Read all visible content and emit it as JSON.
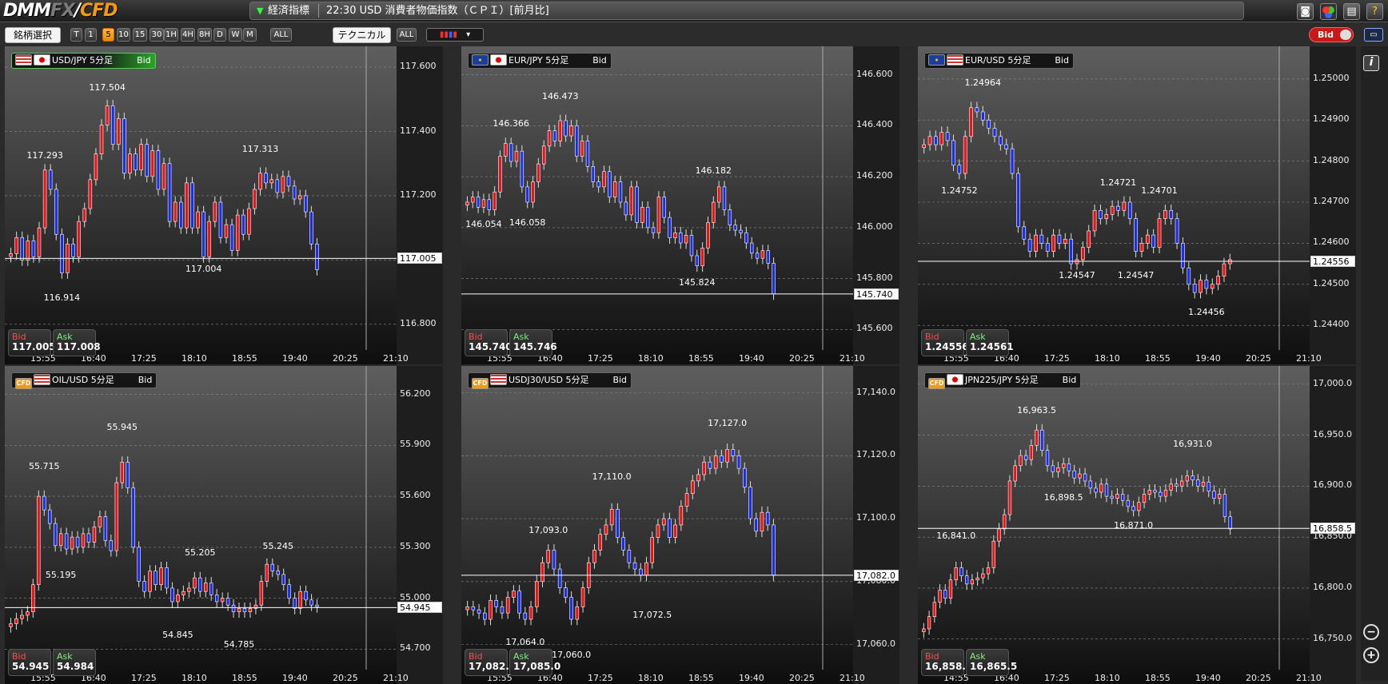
{
  "app": {
    "logo_main": "DMM",
    "logo_fx": "FX",
    "logo_sep": "/",
    "logo_cfd": "CFD"
  },
  "ticker": {
    "category": "経済指標",
    "news": "22:30 USD 消費者物価指数（ＣＰＩ）[前月比]"
  },
  "top_icons": [
    "camera-icon",
    "color-palette-icon",
    "print-icon",
    "help-icon"
  ],
  "toolbar": {
    "symbol_select": "銘柄選択",
    "timeframes": [
      "T",
      "1",
      "5",
      "10",
      "15",
      "30",
      "1H",
      "4H",
      "8H",
      "D",
      "W",
      "M"
    ],
    "active_timeframe": "5",
    "all_label": "ALL",
    "technical_label": "テクニカル",
    "technical_all": "ALL",
    "bid_toggle": "Bid"
  },
  "colors": {
    "up": "#e8141a",
    "down": "#1a2de8",
    "flat": "#d6c326",
    "accent": "#f39a12",
    "bid_text": "#ff4c4c",
    "ask_text": "#7cf07c"
  },
  "panels": [
    {
      "header": "USD/JPY 5分足",
      "bid_label": "Bid",
      "flags": [
        "us",
        "jp"
      ],
      "active": true,
      "yticks": [
        "117.600",
        "117.400",
        "117.200",
        "117.000",
        "116.800"
      ],
      "ymin": 116.72,
      "ymax": 117.64,
      "current": "117.005",
      "current_value": 117.005,
      "xticks": [
        "15:55",
        "16:40",
        "17:25",
        "18:10",
        "18:55",
        "19:40",
        "20:25",
        "21:10"
      ],
      "bid_quote": "117.005",
      "ask_quote": "117.008",
      "annotations": [
        {
          "text": "117.504",
          "value": 117.504,
          "idx": 17,
          "pos": "above"
        },
        {
          "text": "117.293",
          "value": 117.293,
          "idx": 6,
          "pos": "above"
        },
        {
          "text": "117.313",
          "value": 117.313,
          "idx": 44,
          "pos": "above"
        },
        {
          "text": "116.914",
          "value": 116.914,
          "idx": 9,
          "pos": "below"
        },
        {
          "text": "117.004",
          "value": 117.004,
          "idx": 34,
          "pos": "below"
        }
      ],
      "candles": [
        117.02,
        117.07,
        117.0,
        117.06,
        117.01,
        117.1,
        117.28,
        117.22,
        117.08,
        116.96,
        117.05,
        117.01,
        117.12,
        117.16,
        117.25,
        117.33,
        117.42,
        117.48,
        117.36,
        117.44,
        117.27,
        117.33,
        117.28,
        117.36,
        117.26,
        117.34,
        117.22,
        117.3,
        117.12,
        117.18,
        117.1,
        117.24,
        117.1,
        117.15,
        117.01,
        117.12,
        117.18,
        117.07,
        117.11,
        117.03,
        117.14,
        117.08,
        117.16,
        117.22,
        117.27,
        117.24,
        117.25,
        117.21,
        117.26,
        117.23,
        117.19,
        117.2,
        117.15,
        117.05,
        116.97
      ]
    },
    {
      "header": "EUR/JPY 5分足",
      "bid_label": "Bid",
      "flags": [
        "eu",
        "jp"
      ],
      "active": false,
      "yticks": [
        "146.600",
        "146.400",
        "146.200",
        "146.000",
        "145.800",
        "145.600"
      ],
      "ymin": 145.52,
      "ymax": 146.68,
      "current": "145.740",
      "current_value": 145.74,
      "xticks": [
        "15:55",
        "16:40",
        "17:25",
        "18:10",
        "18:55",
        "19:40",
        "20:25",
        "21:10"
      ],
      "bid_quote": "145.740",
      "ask_quote": "145.746",
      "annotations": [
        {
          "text": "146.473",
          "value": 146.473,
          "idx": 17,
          "pos": "above"
        },
        {
          "text": "146.366",
          "value": 146.366,
          "idx": 8,
          "pos": "above"
        },
        {
          "text": "146.182",
          "value": 146.182,
          "idx": 45,
          "pos": "above"
        },
        {
          "text": "146.054",
          "value": 146.054,
          "idx": 3,
          "pos": "below"
        },
        {
          "text": "146.058",
          "value": 146.058,
          "idx": 11,
          "pos": "below"
        },
        {
          "text": "145.824",
          "value": 145.824,
          "idx": 42,
          "pos": "below"
        }
      ],
      "candles": [
        146.1,
        146.12,
        146.08,
        146.11,
        146.07,
        146.14,
        146.28,
        146.33,
        146.26,
        146.3,
        146.16,
        146.1,
        146.18,
        146.25,
        146.32,
        146.38,
        146.34,
        146.42,
        146.36,
        146.4,
        146.28,
        146.34,
        146.24,
        146.18,
        146.16,
        146.22,
        146.12,
        146.18,
        146.1,
        146.05,
        146.16,
        146.02,
        146.08,
        146.0,
        145.98,
        146.12,
        146.04,
        145.96,
        145.98,
        145.94,
        145.97,
        145.89,
        145.85,
        145.92,
        146.02,
        146.1,
        146.16,
        146.07,
        146.01,
        145.99,
        145.98,
        145.94,
        145.9,
        145.88,
        145.91,
        145.86,
        145.74
      ]
    },
    {
      "header": "EUR/USD 5分足",
      "bid_label": "Bid",
      "flags": [
        "eu",
        "us"
      ],
      "active": false,
      "yticks": [
        "1.25000",
        "1.24900",
        "1.24800",
        "1.24700",
        "1.24600",
        "1.24500",
        "1.24400"
      ],
      "ymin": 1.2434,
      "ymax": 1.2506,
      "current": "1.24556",
      "current_value": 1.24556,
      "xticks": [
        "15:55",
        "16:40",
        "17:25",
        "18:10",
        "18:55",
        "19:40",
        "20:25",
        "21:10"
      ],
      "bid_quote": "1.24556",
      "ask_quote": "1.24561",
      "annotations": [
        {
          "text": "1.24964",
          "value": 1.24964,
          "idx": 10,
          "pos": "above"
        },
        {
          "text": "1.24752",
          "value": 1.24752,
          "idx": 6,
          "pos": "below"
        },
        {
          "text": "1.24721",
          "value": 1.24721,
          "idx": 33,
          "pos": "above"
        },
        {
          "text": "1.24701",
          "value": 1.24701,
          "idx": 40,
          "pos": "above"
        },
        {
          "text": "1.24547",
          "value": 1.24547,
          "idx": 26,
          "pos": "below"
        },
        {
          "text": "1.24547",
          "value": 1.24547,
          "idx": 36,
          "pos": "below"
        },
        {
          "text": "1.24456",
          "value": 1.24456,
          "idx": 48,
          "pos": "below"
        }
      ],
      "candles": [
        1.2484,
        1.2486,
        1.2484,
        1.2487,
        1.2485,
        1.2479,
        1.2477,
        1.2486,
        1.2493,
        1.2492,
        1.249,
        1.2488,
        1.2486,
        1.2484,
        1.2483,
        1.2477,
        1.2464,
        1.2461,
        1.2458,
        1.2462,
        1.246,
        1.2458,
        1.2462,
        1.246,
        1.2461,
        1.2455,
        1.2456,
        1.2459,
        1.2463,
        1.2468,
        1.2466,
        1.2467,
        1.2469,
        1.2468,
        1.247,
        1.2466,
        1.2458,
        1.246,
        1.2462,
        1.2459,
        1.2466,
        1.2468,
        1.2466,
        1.246,
        1.2454,
        1.245,
        1.2448,
        1.2451,
        1.2449,
        1.245,
        1.2452,
        1.2455,
        1.2456
      ]
    },
    {
      "header": "OIL/USD 5分足",
      "bid_label": "Bid",
      "flags": [
        "cfd",
        "us"
      ],
      "active": false,
      "yticks": [
        "56.200",
        "55.900",
        "55.600",
        "55.300",
        "55.000",
        "54.700"
      ],
      "ymin": 54.58,
      "ymax": 56.32,
      "current": "54.945",
      "current_value": 54.945,
      "xticks": [
        "15:55",
        "16:40",
        "17:25",
        "18:10",
        "18:55",
        "19:40",
        "20:25",
        "21:10"
      ],
      "bid_quote": "54.945",
      "ask_quote": "54.984",
      "annotations": [
        {
          "text": "55.945",
          "value": 55.945,
          "idx": 20,
          "pos": "above"
        },
        {
          "text": "55.715",
          "value": 55.715,
          "idx": 6,
          "pos": "above"
        },
        {
          "text": "55.195",
          "value": 55.195,
          "idx": 9,
          "pos": "below"
        },
        {
          "text": "55.205",
          "value": 55.205,
          "idx": 34,
          "pos": "above"
        },
        {
          "text": "55.245",
          "value": 55.245,
          "idx": 48,
          "pos": "above"
        },
        {
          "text": "54.845",
          "value": 54.845,
          "idx": 30,
          "pos": "below"
        },
        {
          "text": "54.785",
          "value": 54.785,
          "idx": 41,
          "pos": "below"
        }
      ],
      "candles": [
        54.85,
        54.88,
        54.9,
        54.92,
        55.08,
        55.6,
        55.52,
        55.44,
        55.31,
        55.38,
        55.29,
        55.36,
        55.3,
        55.38,
        55.33,
        55.42,
        55.48,
        55.34,
        55.28,
        55.68,
        55.8,
        55.65,
        55.3,
        55.1,
        55.04,
        55.16,
        55.08,
        55.18,
        55.06,
        54.98,
        55.02,
        55.04,
        55.06,
        55.12,
        55.04,
        55.09,
        55.02,
        54.98,
        55.0,
        54.96,
        54.92,
        54.94,
        54.92,
        54.94,
        54.96,
        55.1,
        55.2,
        55.16,
        55.14,
        55.08,
        55.0,
        54.94,
        55.04,
        54.99,
        54.96,
        54.95
      ]
    },
    {
      "header": "USDJ30/USD 5分足",
      "bid_label": "Bid",
      "flags": [
        "cfd",
        "us"
      ],
      "active": false,
      "yticks": [
        "17,140.0",
        "17,120.0",
        "17,100.0",
        "17,080.0",
        "17,060.0"
      ],
      "ymin": 17052.0,
      "ymax": 17146.0,
      "current": "17,082.0",
      "current_value": 17082.0,
      "xticks": [
        "15:55",
        "16:40",
        "17:25",
        "18:10",
        "18:55",
        "19:40",
        "20:25",
        "21:10"
      ],
      "bid_quote": "17,082.0",
      "ask_quote": "17,085.0",
      "annotations": [
        {
          "text": "17,127.0",
          "value": 17127.0,
          "idx": 45,
          "pos": "above"
        },
        {
          "text": "17,110.0",
          "value": 17110.0,
          "idx": 25,
          "pos": "above"
        },
        {
          "text": "17,093.0",
          "value": 17093.0,
          "idx": 14,
          "pos": "above"
        },
        {
          "text": "17,064.0",
          "value": 17064.0,
          "idx": 10,
          "pos": "below"
        },
        {
          "text": "17,060.0",
          "value": 17060.0,
          "idx": 18,
          "pos": "below"
        },
        {
          "text": "17,072.5",
          "value": 17072.5,
          "idx": 32,
          "pos": "below"
        }
      ],
      "candles": [
        17072,
        17071,
        17070,
        17068,
        17074,
        17072,
        17070,
        17075,
        17077,
        17070,
        17068,
        17072,
        17080,
        17086,
        17090,
        17084,
        17078,
        17075,
        17068,
        17072,
        17078,
        17086,
        17090,
        17095,
        17098,
        17103,
        17094,
        17090,
        17086,
        17084,
        17082,
        17086,
        17094,
        17098,
        17100,
        17094,
        17098,
        17104,
        17108,
        17112,
        17114,
        17118,
        17116,
        17120,
        17118,
        17122,
        17120,
        17116,
        17110,
        17100,
        17096,
        17102,
        17098,
        17082
      ]
    },
    {
      "header": "JPN225/JPY 5分足",
      "bid_label": "Bid",
      "flags": [
        "cfd",
        "jp"
      ],
      "active": false,
      "yticks": [
        "17,000.0",
        "16,950.0",
        "16,900.0",
        "16,850.0",
        "16,800.0",
        "16,750.0"
      ],
      "ymin": 16720.0,
      "ymax": 17010.0,
      "current": "16,858.5",
      "current_value": 16858.5,
      "xticks": [
        "14:55",
        "16:40",
        "17:25",
        "18:10",
        "18:55",
        "19:40",
        "20:25",
        "21:10"
      ],
      "bid_quote": "16,858.5",
      "ask_quote": "16,865.5",
      "annotations": [
        {
          "text": "16,963.5",
          "value": 16963.5,
          "idx": 21,
          "pos": "above"
        },
        {
          "text": "16,841.0",
          "value": 16841.0,
          "idx": 6,
          "pos": "above"
        },
        {
          "text": "16,898.5",
          "value": 16898.5,
          "idx": 26,
          "pos": "below"
        },
        {
          "text": "16,931.0",
          "value": 16931.0,
          "idx": 50,
          "pos": "above"
        },
        {
          "text": "16,871.0",
          "value": 16871.0,
          "idx": 39,
          "pos": "below"
        }
      ],
      "candles": [
        16760,
        16772,
        16786,
        16798,
        16790,
        16808,
        16820,
        16812,
        16804,
        16808,
        16810,
        16814,
        16820,
        16846,
        16858,
        16872,
        16905,
        16920,
        16930,
        16926,
        16940,
        16955,
        16935,
        16920,
        16914,
        16918,
        16922,
        16915,
        16908,
        16912,
        16905,
        16898,
        16894,
        16902,
        16890,
        16888,
        16892,
        16886,
        16880,
        16876,
        16884,
        16892,
        16896,
        16894,
        16890,
        16896,
        16902,
        16900,
        16905,
        16910,
        16906,
        16900,
        16904,
        16895,
        16888,
        16892,
        16870,
        16858
      ]
    }
  ],
  "sidebar": {
    "info_icon": "i",
    "zoom_out_icon": "−",
    "zoom_in_icon": "+"
  }
}
